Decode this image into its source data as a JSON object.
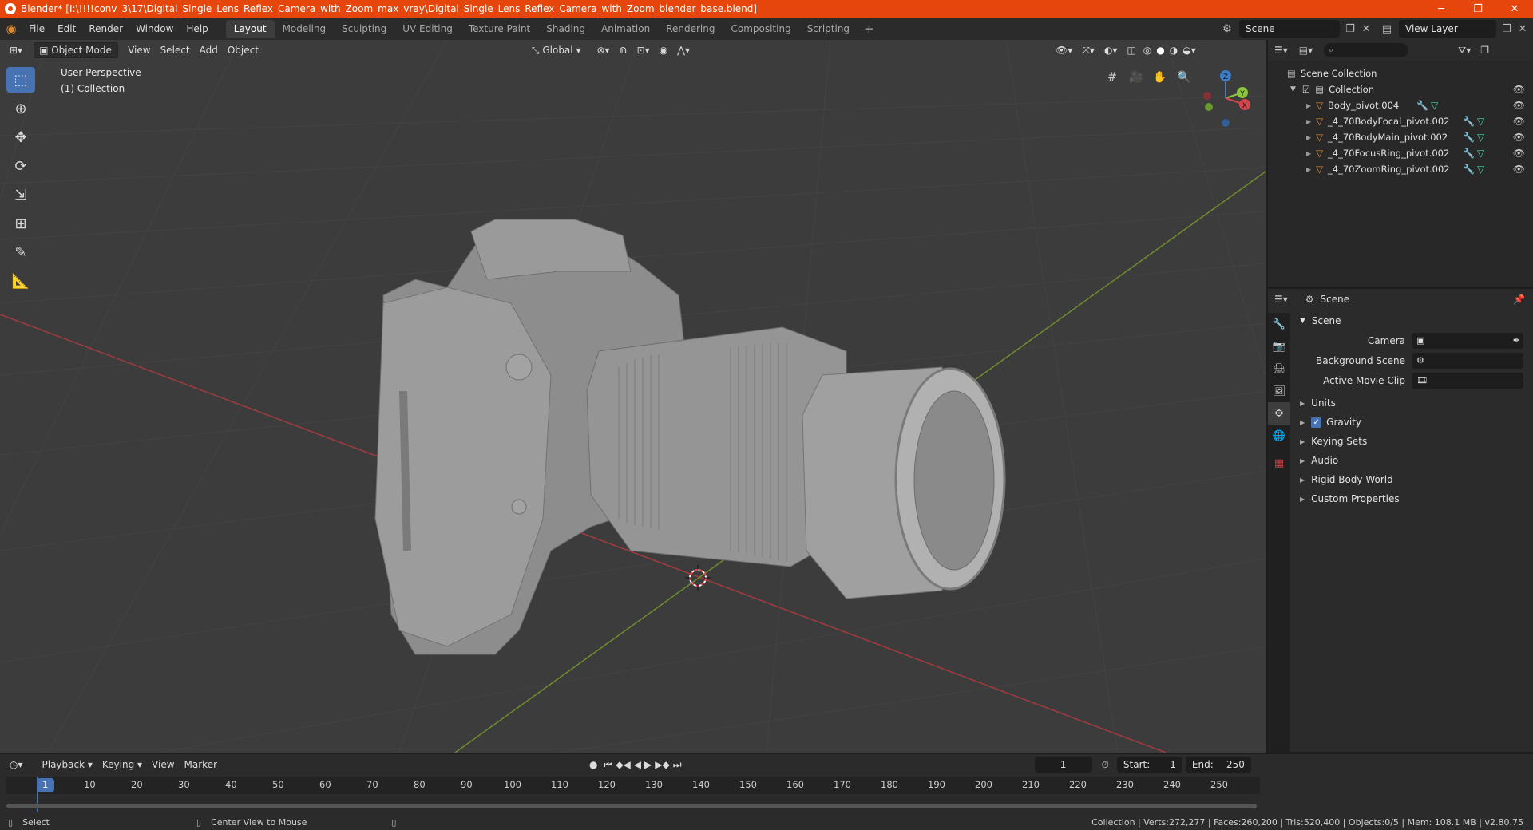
{
  "window": {
    "title": "Blender* [I:\\!!!!conv_3\\17\\Digital_Single_Lens_Reflex_Camera_with_Zoom_max_vray\\Digital_Single_Lens_Reflex_Camera_with_Zoom_blender_base.blend]",
    "minimize": "─",
    "maximize": "❐",
    "close": "✕"
  },
  "menu": [
    "File",
    "Edit",
    "Render",
    "Window",
    "Help"
  ],
  "workspaces": {
    "tabs": [
      "Layout",
      "Modeling",
      "Sculpting",
      "UV Editing",
      "Texture Paint",
      "Shading",
      "Animation",
      "Rendering",
      "Compositing",
      "Scripting"
    ],
    "active": "Layout",
    "plus": "+"
  },
  "scene_selector": {
    "value": "Scene"
  },
  "view_layer_selector": {
    "value": "View Layer"
  },
  "viewport": {
    "mode": "Object Mode",
    "menus": [
      "View",
      "Select",
      "Add",
      "Object"
    ],
    "orientation": "Global",
    "perspective_label": "User Perspective",
    "collection_label": "(1) Collection",
    "gizmo": {
      "x": "X",
      "y": "Y",
      "z": "Z"
    }
  },
  "outliner": {
    "search_placeholder": "",
    "root": "Scene Collection",
    "collection": "Collection",
    "objects": [
      "Body_pivot.004",
      "_4_70BodyFocal_pivot.002",
      "_4_70BodyMain_pivot.002",
      "_4_70FocusRing_pivot.002",
      "_4_70ZoomRing_pivot.002"
    ]
  },
  "properties": {
    "header": "Scene",
    "section": "Scene",
    "fields": [
      {
        "label": "Camera",
        "value": ""
      },
      {
        "label": "Background Scene",
        "value": ""
      },
      {
        "label": "Active Movie Clip",
        "value": ""
      }
    ],
    "subsections": [
      "Units",
      "Gravity",
      "Keying Sets",
      "Audio",
      "Rigid Body World",
      "Custom Properties"
    ],
    "gravity_checked": true
  },
  "timeline": {
    "menus": [
      "Playback",
      "Keying",
      "View",
      "Marker"
    ],
    "current_frame": "1",
    "start_label": "Start:",
    "start": "1",
    "end_label": "End:",
    "end": "250",
    "ruler": [
      "1",
      "10",
      "20",
      "30",
      "40",
      "50",
      "60",
      "70",
      "80",
      "90",
      "100",
      "110",
      "120",
      "130",
      "140",
      "150",
      "160",
      "170",
      "180",
      "190",
      "200",
      "210",
      "220",
      "230",
      "240",
      "250"
    ]
  },
  "status": {
    "left": "Select",
    "middle": "Center View to Mouse",
    "right": "Collection | Verts:272,277 | Faces:260,200 | Tris:520,400 | Objects:0/5 | Mem: 108.1 MB | v2.80.75"
  },
  "colors": {
    "accent": "#4772b3",
    "title_bar": "#e6460c",
    "x_axis": "#d9454c",
    "y_axis": "#8bc53f",
    "z_axis": "#3d7dc8"
  }
}
